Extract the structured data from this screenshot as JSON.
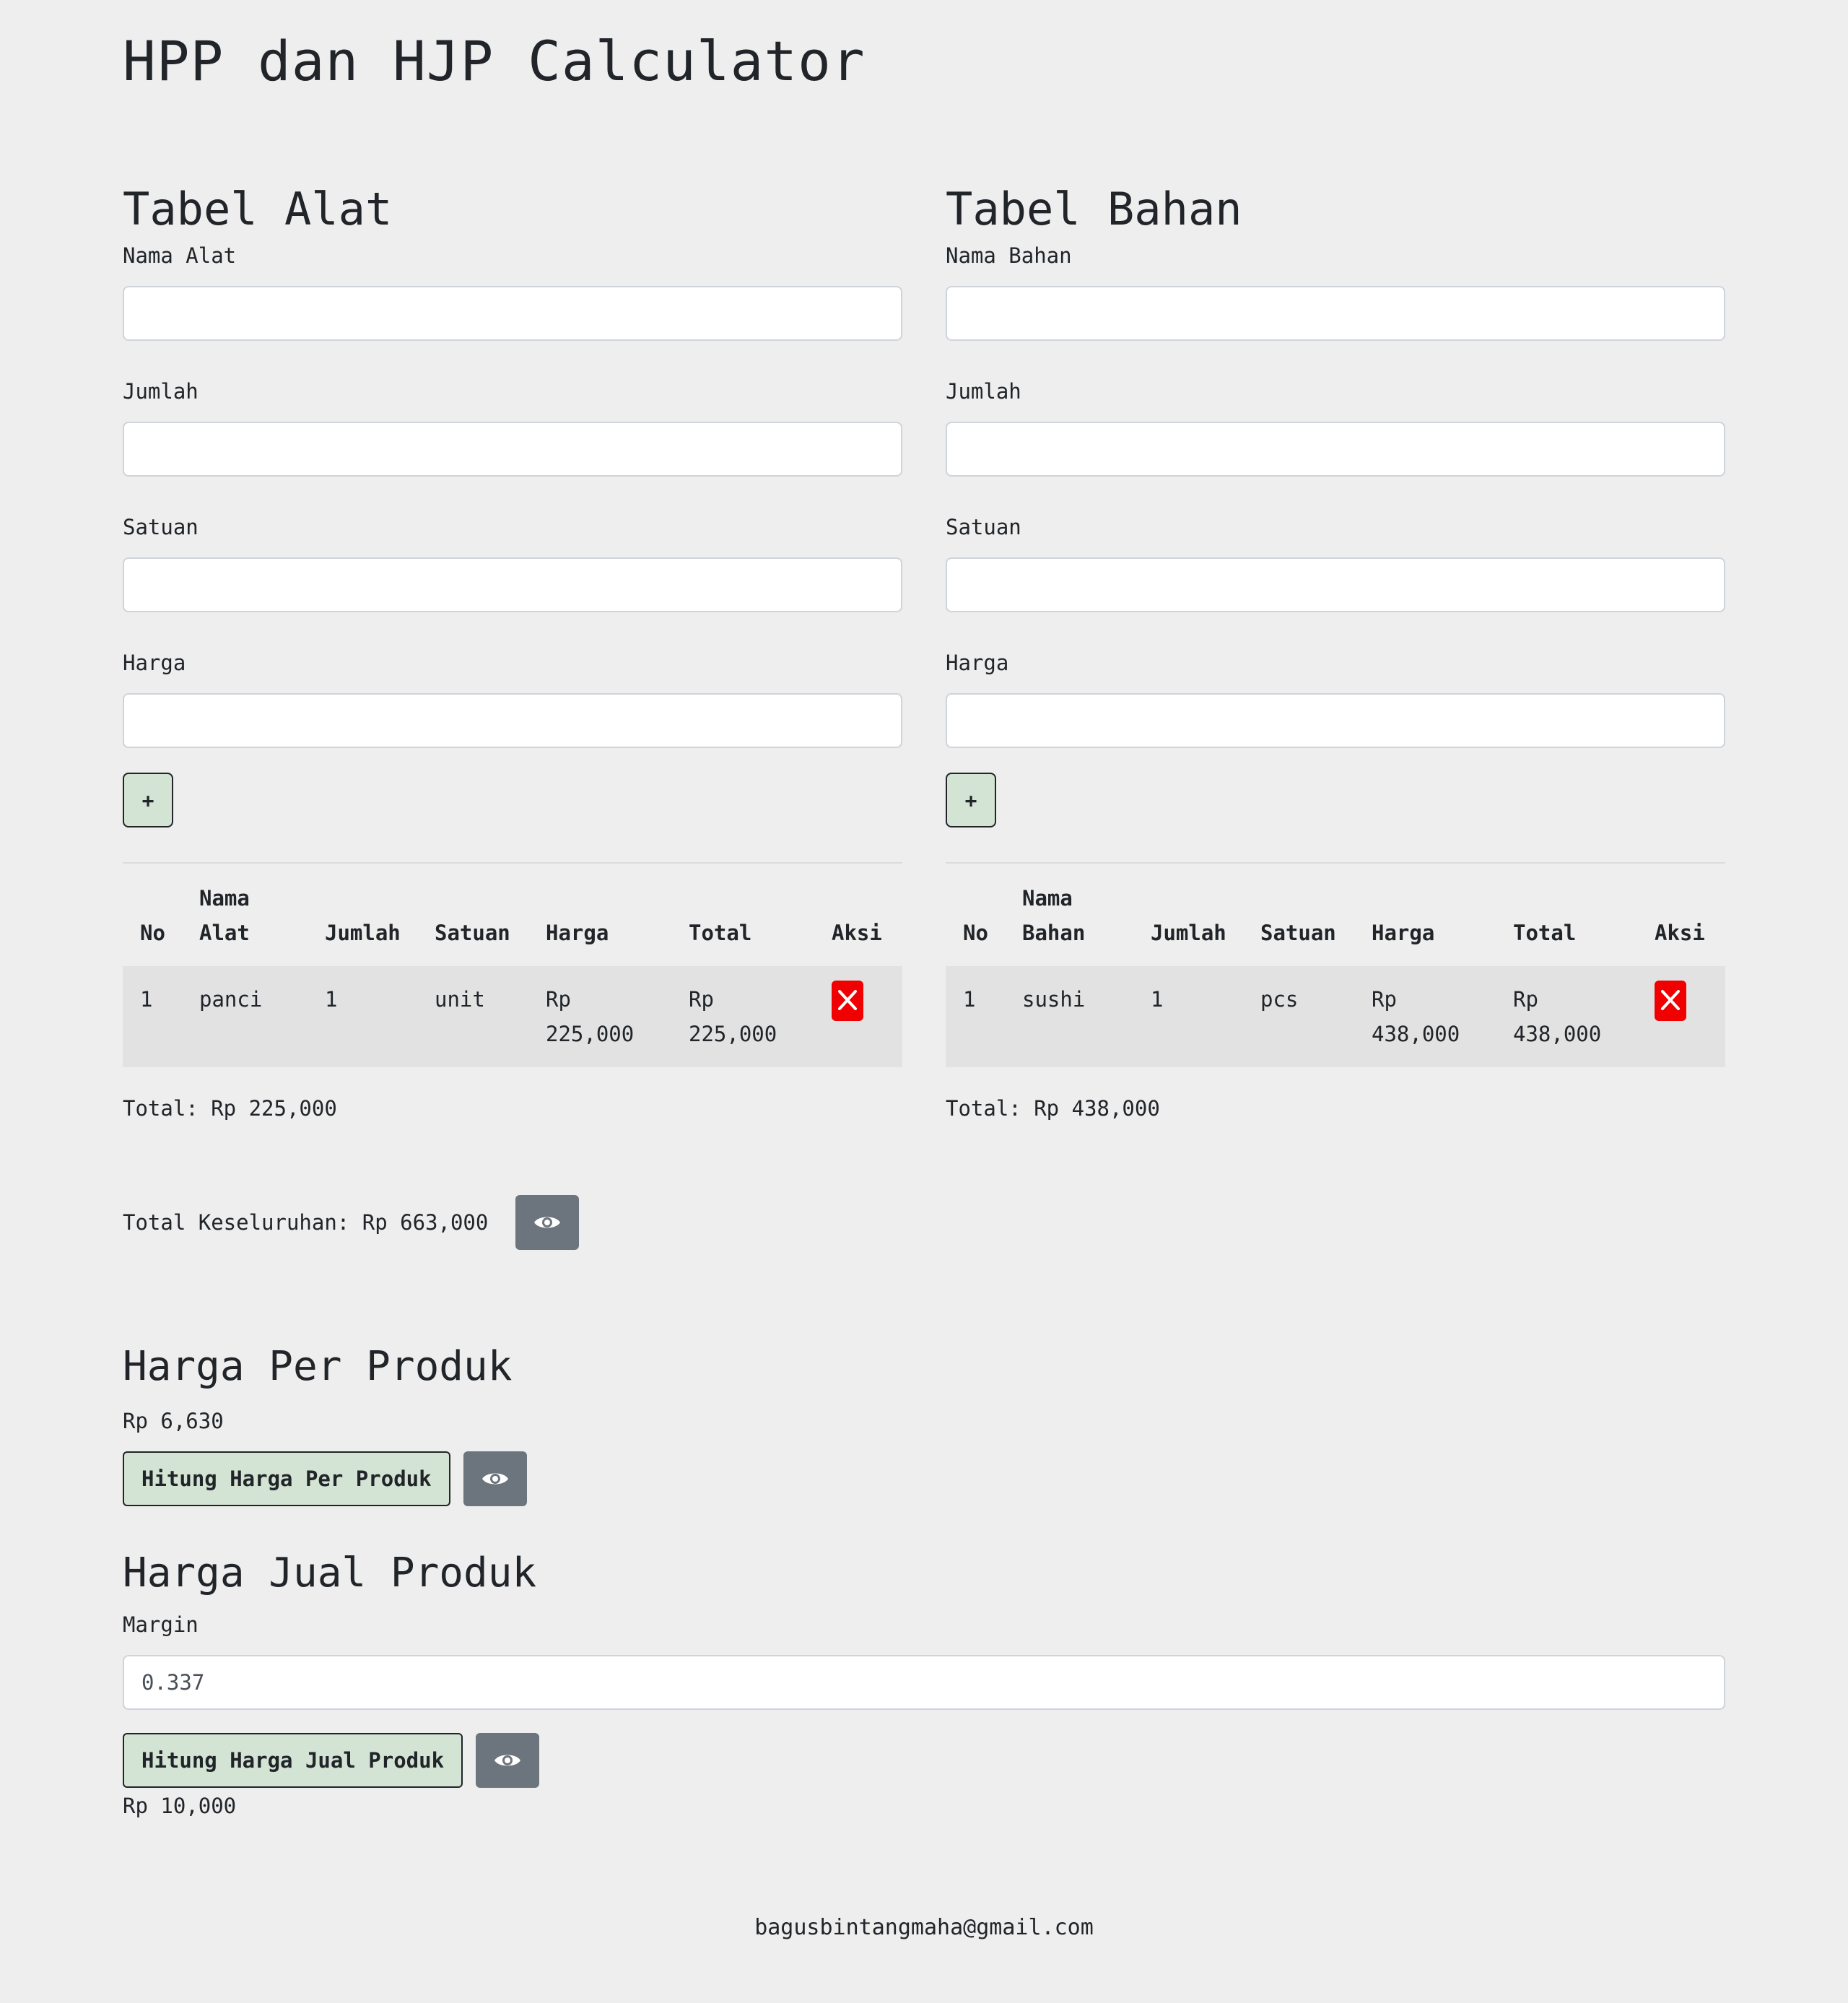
{
  "app": {
    "title": "HPP dan HJP Calculator"
  },
  "alat": {
    "heading": "Tabel Alat",
    "fields": {
      "nama": "Nama Alat",
      "jumlah": "Jumlah",
      "satuan": "Satuan",
      "harga": "Harga"
    },
    "add_label": "+",
    "columns": {
      "no": "No",
      "nama": "Nama Alat",
      "jumlah": "Jumlah",
      "satuan": "Satuan",
      "harga": "Harga",
      "total": "Total",
      "aksi": "Aksi"
    },
    "rows": [
      {
        "no": "1",
        "nama": "panci",
        "jumlah": "1",
        "satuan": "unit",
        "harga": "Rp 225,000",
        "total": "Rp 225,000"
      }
    ],
    "total_text": "Total: Rp 225,000"
  },
  "bahan": {
    "heading": "Tabel Bahan",
    "fields": {
      "nama": "Nama Bahan",
      "jumlah": "Jumlah",
      "satuan": "Satuan",
      "harga": "Harga"
    },
    "add_label": "+",
    "columns": {
      "no": "No",
      "nama": "Nama Bahan",
      "jumlah": "Jumlah",
      "satuan": "Satuan",
      "harga": "Harga",
      "total": "Total",
      "aksi": "Aksi"
    },
    "rows": [
      {
        "no": "1",
        "nama": "sushi",
        "jumlah": "1",
        "satuan": "pcs",
        "harga": "Rp 438,000",
        "total": "Rp 438,000"
      }
    ],
    "total_text": "Total: Rp 438,000"
  },
  "grand_total": {
    "text": "Total Keseluruhan: Rp 663,000",
    "icon": "eye-icon"
  },
  "per_produk": {
    "heading": "Harga Per Produk",
    "value": "Rp 6,630",
    "button": "Hitung Harga Per Produk"
  },
  "jual_produk": {
    "heading": "Harga Jual Produk",
    "margin_label": "Margin",
    "margin_value": "0.337",
    "button": "Hitung Harga Jual Produk",
    "result": "Rp 10,000"
  },
  "footer": {
    "email": "bagusbintangmaha@gmail.com"
  },
  "colors": {
    "background": "#eeeeee",
    "delete": "#f00000",
    "eye_button": "#6c757d",
    "action_button": "#d4e4d4"
  }
}
